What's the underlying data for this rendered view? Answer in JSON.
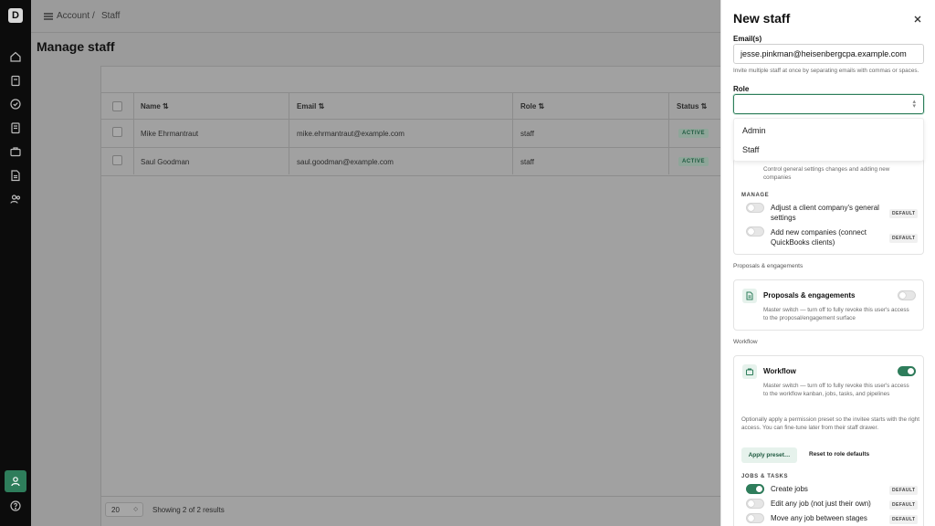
{
  "nav": {
    "logo": "D",
    "items": [
      "home-icon",
      "clipboard-icon",
      "check-circle-icon",
      "document-icon",
      "briefcase-icon",
      "file-text-icon",
      "users-icon"
    ],
    "bottom": [
      "user-icon",
      "help-icon"
    ]
  },
  "breadcrumb": {
    "part1": "Account",
    "sep": "/",
    "part2": "Staff"
  },
  "page": {
    "title": "Manage staff"
  },
  "table": {
    "columns": [
      "Name ⇅",
      "Email ⇅",
      "Role ⇅",
      "Status ⇅"
    ],
    "rows": [
      {
        "name": "Mike Ehrmantraut",
        "email": "mike.ehrmantraut@example.com",
        "role": "staff",
        "status": "ACTIVE"
      },
      {
        "name": "Saul Goodman",
        "email": "saul.goodman@example.com",
        "role": "staff",
        "status": "ACTIVE"
      }
    ],
    "page_size": "20",
    "showing": "Showing 2 of 2 results"
  },
  "drawer": {
    "title": "New staff",
    "emails_label": "Email(s)",
    "emails_value": "jesse.pinkman@heisenbergcpa.example.com",
    "emails_hint": "Invite multiple staff at once by separating emails with commas or spaces.",
    "role_label": "Role",
    "role_value": "",
    "role_options": [
      "Admin",
      "Staff"
    ],
    "settings": {
      "desc": "Control general settings changes and adding new companies",
      "manage_label": "MANAGE",
      "items": [
        {
          "label": "Adjust a client company's general settings",
          "badge": "DEFAULT"
        },
        {
          "label": "Add new companies (connect QuickBooks clients)",
          "badge": "DEFAULT"
        }
      ]
    },
    "proposals": {
      "section_label": "Proposals & engagements",
      "title": "Proposals & engagements",
      "desc": "Master switch — turn off to fully revoke this user's access to the proposal/engagement surface",
      "enabled": false
    },
    "workflow": {
      "section_label": "Workflow",
      "title": "Workflow",
      "desc": "Master switch — turn off to fully revoke this user's access to the workflow kanban, jobs, tasks, and pipelines",
      "enabled": true,
      "preset_hint": "Optionally apply a permission preset so the invitee starts with the right access. You can fine-tune later from their staff drawer.",
      "apply_preset": "Apply preset…",
      "reset": "Reset to role defaults",
      "jobs_label": "JOBS & TASKS",
      "items": [
        {
          "label": "Create jobs",
          "badge": "DEFAULT",
          "on": true
        },
        {
          "label": "Edit any job (not just their own)",
          "badge": "DEFAULT",
          "on": false
        },
        {
          "label": "Move any job between stages",
          "badge": "DEFAULT",
          "on": false
        }
      ]
    }
  },
  "colors": {
    "accent": "#2e7d5b",
    "overlay": "#9b9b9b",
    "rail": "#0c0c0c"
  }
}
